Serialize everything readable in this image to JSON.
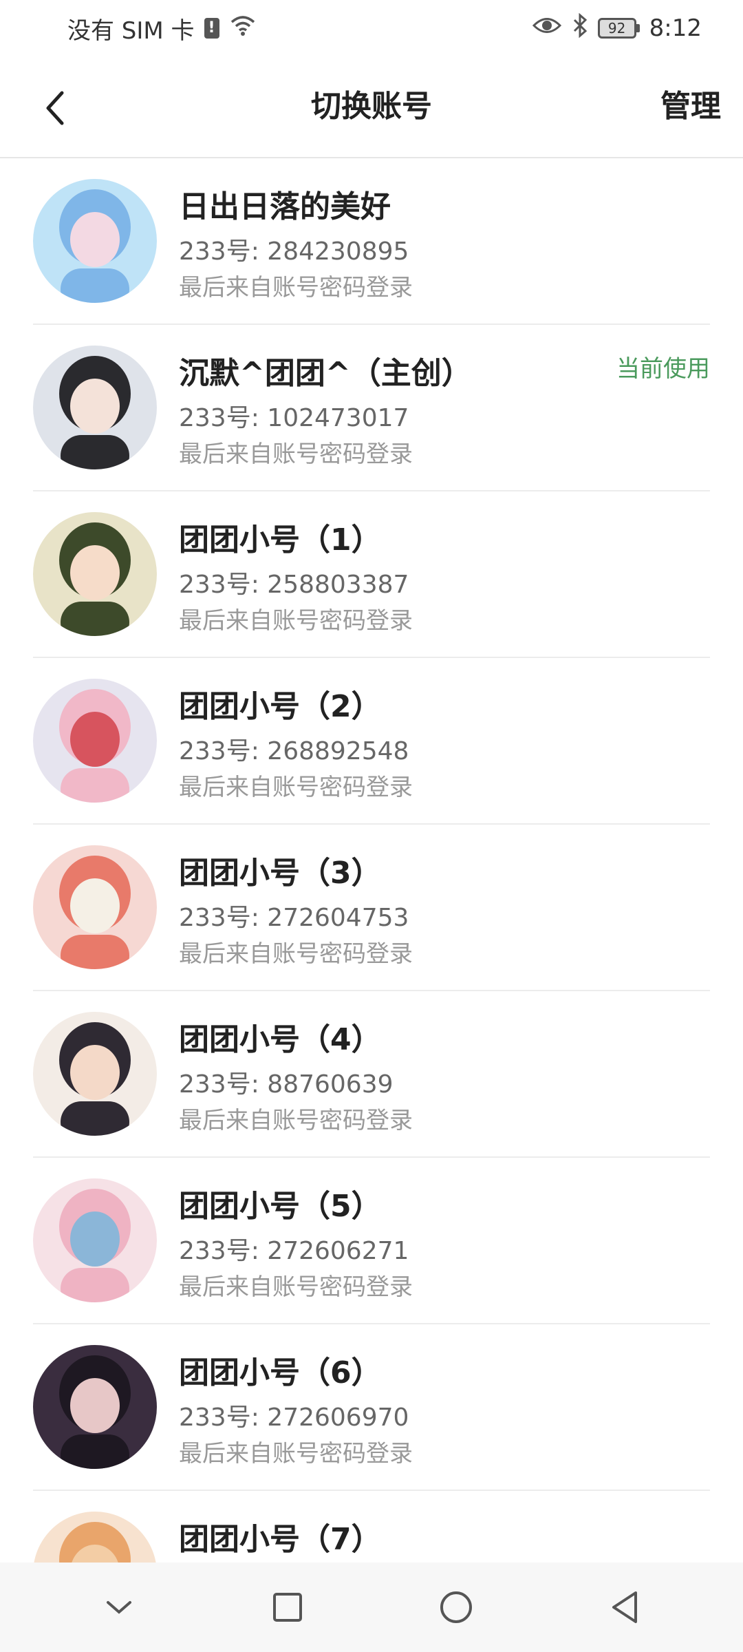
{
  "status_bar": {
    "carrier": "没有 SIM 卡",
    "sim_alert": "!",
    "battery": "92",
    "time": "8:12",
    "icons": [
      "sim-alert-icon",
      "wifi-icon",
      "eye-icon",
      "bluetooth-icon",
      "battery-icon"
    ]
  },
  "header": {
    "title": "切换账号",
    "manage_label": "管理",
    "back_icon": "chevron-left-icon"
  },
  "accounts": [
    {
      "name": "日出日落的美好",
      "id": "233号: 284230895",
      "login": "最后来自账号密码登录",
      "badge": "",
      "avatar_colors": [
        "#bfe3f7",
        "#7fb6e8",
        "#f3d9e3"
      ]
    },
    {
      "name": "沉默^团团^（主创）",
      "id": "233号: 102473017",
      "login": "最后来自账号密码登录",
      "badge": "当前使用",
      "avatar_colors": [
        "#dfe3ea",
        "#2a2a2e",
        "#f4e2d9"
      ]
    },
    {
      "name": "团团小号（1）",
      "id": "233号: 258803387",
      "login": "最后来自账号密码登录",
      "badge": "",
      "avatar_colors": [
        "#e8e3c8",
        "#3d4a2a",
        "#f6dcc9"
      ]
    },
    {
      "name": "团团小号（2）",
      "id": "233号: 268892548",
      "login": "最后来自账号密码登录",
      "badge": "",
      "avatar_colors": [
        "#e6e4ef",
        "#f1b8c8",
        "#d7545e"
      ]
    },
    {
      "name": "团团小号（3）",
      "id": "233号: 272604753",
      "login": "最后来自账号密码登录",
      "badge": "",
      "avatar_colors": [
        "#f6d8d3",
        "#e87a6a",
        "#f5f0e6"
      ]
    },
    {
      "name": "团团小号（4）",
      "id": "233号: 88760639",
      "login": "最后来自账号密码登录",
      "badge": "",
      "avatar_colors": [
        "#f3ece6",
        "#2f2a33",
        "#f4d9c8"
      ]
    },
    {
      "name": "团团小号（5）",
      "id": "233号: 272606271",
      "login": "最后来自账号密码登录",
      "badge": "",
      "avatar_colors": [
        "#f6e1e6",
        "#efb3c3",
        "#8bb6d8"
      ]
    },
    {
      "name": "团团小号（6）",
      "id": "233号: 272606970",
      "login": "最后来自账号密码登录",
      "badge": "",
      "avatar_colors": [
        "#3a2d3f",
        "#1e1822",
        "#e7c7c7"
      ]
    },
    {
      "name": "团团小号（7）",
      "id": "",
      "login": "",
      "badge": "",
      "avatar_colors": [
        "#f7e2cf",
        "#e9a56b",
        "#f3cda5"
      ]
    }
  ],
  "nav_bar": {
    "icons": [
      "chevron-down-icon",
      "square-icon",
      "circle-icon",
      "triangle-back-icon"
    ]
  }
}
